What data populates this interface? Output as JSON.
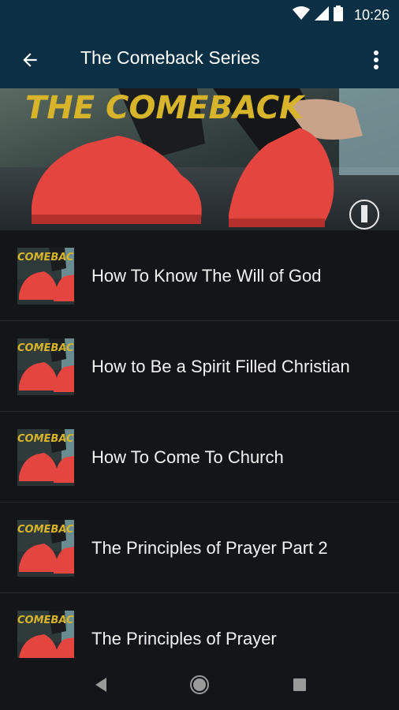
{
  "status_bar": {
    "time": "10:26",
    "icons": [
      "wifi-icon",
      "cell-signal-icon",
      "battery-icon"
    ]
  },
  "app_bar": {
    "title": "The Comeback Series",
    "back_icon": "arrow-back-icon",
    "menu_icon": "more-vert-icon",
    "background": "#0b2f45"
  },
  "hero": {
    "banner_text": "THE COMEBACK"
  },
  "sermons": [
    {
      "title": "How To Know The Will of God",
      "thumb_text": "COMEBACK"
    },
    {
      "title": "How to Be a Spirit Filled Christian",
      "thumb_text": "COMEBACK"
    },
    {
      "title": "How To Come To Church",
      "thumb_text": "COMEBACK"
    },
    {
      "title": "The Principles of Prayer Part 2",
      "thumb_text": "COMEBACK"
    },
    {
      "title": "The Principles of Prayer",
      "thumb_text": "COMEBACK"
    }
  ],
  "nav_bar": {
    "icons": [
      "nav-back-icon",
      "nav-home-icon",
      "nav-recents-icon"
    ]
  },
  "colors": {
    "accent_text": "#d8b42a",
    "shoe_red": "#e4453f",
    "list_background": "#141518"
  }
}
